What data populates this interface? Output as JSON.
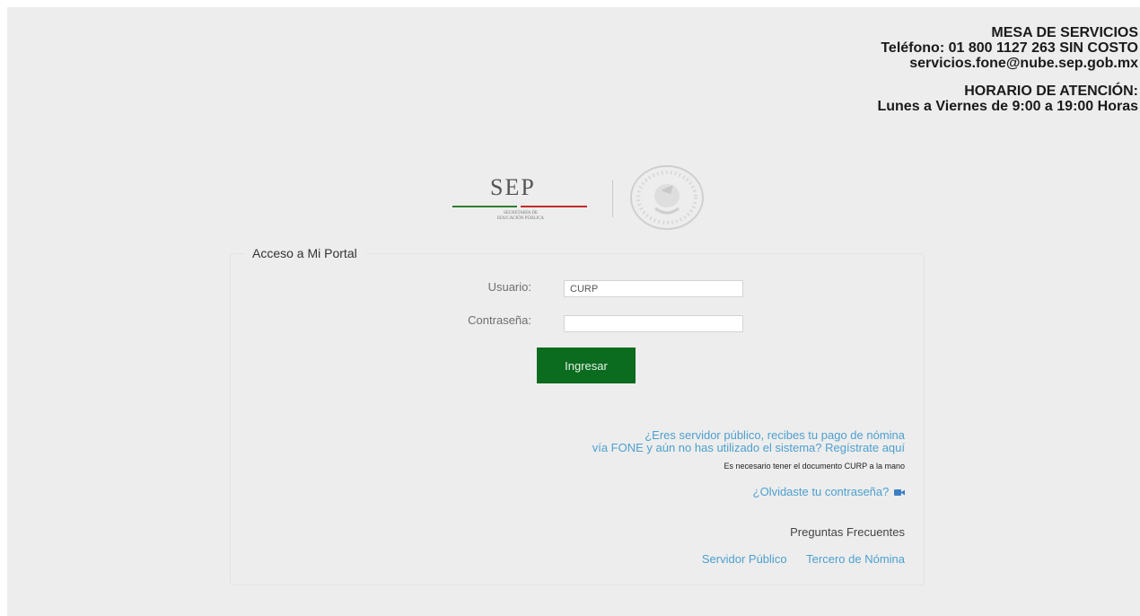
{
  "contact": {
    "title": "MESA DE SERVICIOS",
    "phone": "Teléfono: 01 800 1127 263 SIN COSTO",
    "email": "servicios.fone@nube.sep.gob.mx",
    "hours_title": "HORARIO DE ATENCIÓN:",
    "hours": "Lunes a Viernes de 9:00 a 19:00 Horas"
  },
  "logo": {
    "name": "SEP",
    "subtitle_line1": "SECRETARÍA DE",
    "subtitle_line2": "EDUCACIÓN PÚBLICA",
    "seal_icon": "mexico-seal-icon"
  },
  "login": {
    "legend": "Acceso a Mi Portal",
    "user_label": "Usuario:",
    "user_value": "CURP",
    "password_label": "Contraseña:",
    "password_value": "",
    "submit_label": "Ingresar"
  },
  "links": {
    "register_line1": "¿Eres servidor público, recibes tu pago de nómina",
    "register_line2": "vía FONE y aún no has utilizado el sistema? Regístrate aquí",
    "register_note": "Es necesario tener el documento CURP a la mano",
    "forgot_password": "¿Olvidaste tu contraseña?",
    "forgot_icon": "video-camera-icon",
    "faq_title": "Preguntas Frecuentes",
    "faq_public_servant": "Servidor Público",
    "faq_payroll_third": "Tercero de Nómina"
  },
  "colors": {
    "button": "#0b6b1f",
    "link": "#4da0cf",
    "background": "#ededed"
  }
}
